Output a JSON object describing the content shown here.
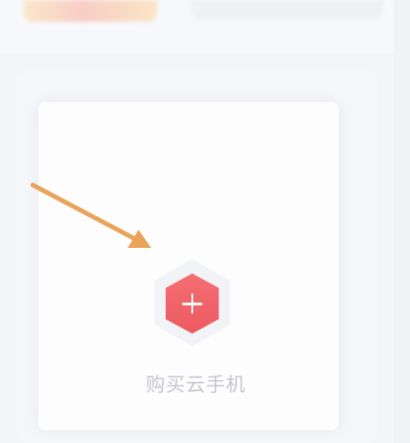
{
  "buy": {
    "label": "购买云手机",
    "icon": "plus-icon"
  },
  "annotation": {
    "arrow_color": "#e9a45a"
  },
  "colors": {
    "button_red": "#ec5a61",
    "label_gray": "#c3c6cc",
    "background": "#f3f5f9"
  }
}
